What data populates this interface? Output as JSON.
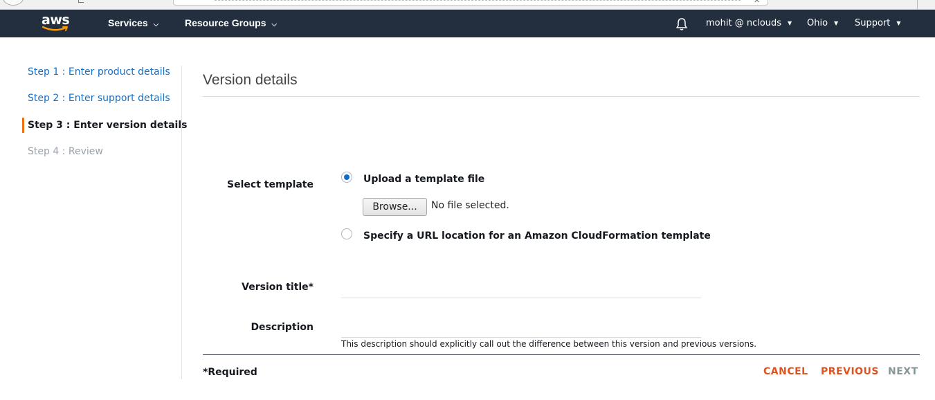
{
  "navbar": {
    "logo_text": "aws",
    "services_label": "Services",
    "resource_groups_label": "Resource Groups",
    "user_label": "mohit @ nclouds",
    "region_label": "Ohio",
    "support_label": "Support",
    "bg_color": "#232f3e"
  },
  "steps": [
    {
      "label": "Step 1 : Enter product details",
      "state": "link"
    },
    {
      "label": "Step 2 : Enter support details",
      "state": "link"
    },
    {
      "label": "Step 3 : Enter version details",
      "state": "active"
    },
    {
      "label": "Step 4 : Review",
      "state": "disabled"
    }
  ],
  "page": {
    "title": "Version details"
  },
  "form": {
    "select_template_label": "Select template",
    "upload_option_label": "Upload a template file",
    "browse_button_label": "Browse...",
    "file_status": "No file selected.",
    "url_option_label": "Specify a URL location for an Amazon CloudFormation template",
    "selected_option": "upload",
    "version_title_label": "Version title*",
    "version_title_value": "",
    "description_label": "Description",
    "description_value": "",
    "description_hint": "This description should explicitly call out the difference between this version and previous versions."
  },
  "footer": {
    "required_label": "*Required",
    "cancel_label": "CANCEL",
    "previous_label": "PREVIOUS",
    "next_label": "NEXT",
    "accent_color": "#e0531e"
  }
}
